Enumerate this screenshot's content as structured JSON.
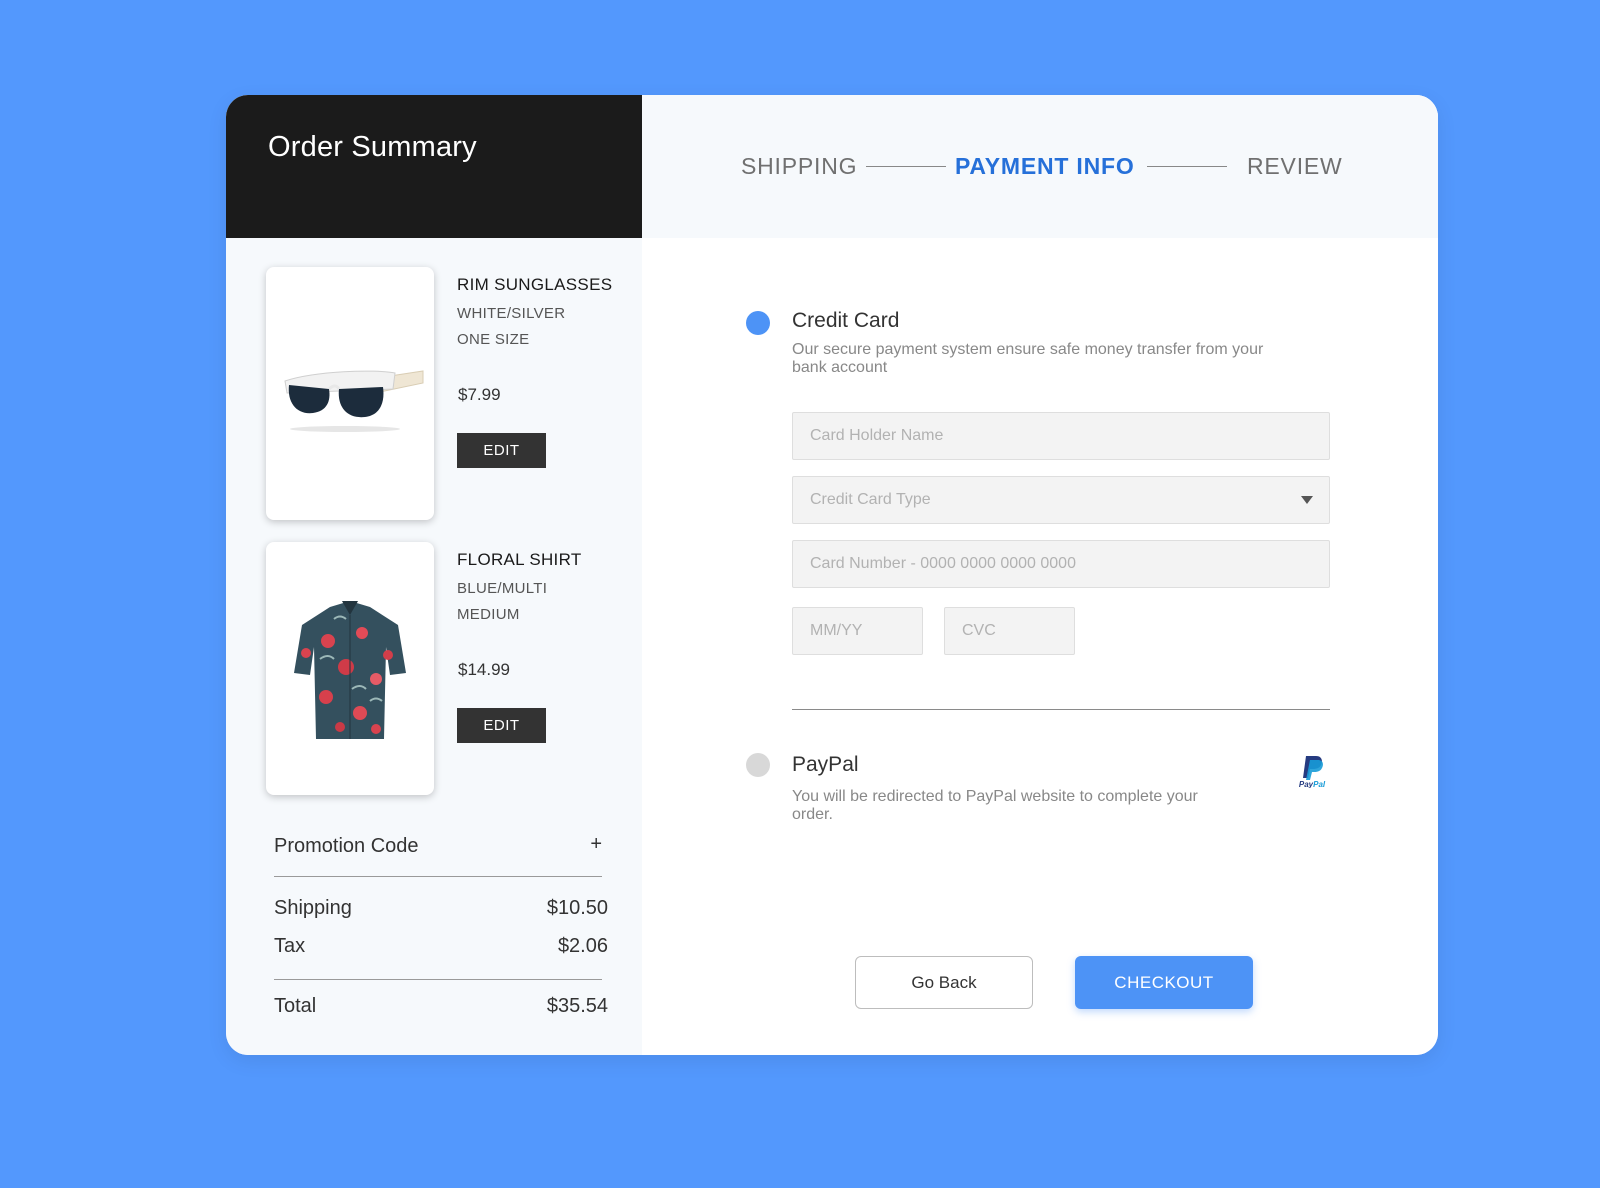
{
  "summary": {
    "title": "Order Summary"
  },
  "items": [
    {
      "name": "RIM SUNGLASSES",
      "color": "WHITE/SILVER",
      "size": "ONE SIZE",
      "price": "$7.99",
      "edit_label": "EDIT"
    },
    {
      "name": "FLORAL SHIRT",
      "color": "BLUE/MULTI",
      "size": "MEDIUM",
      "price": "$14.99",
      "edit_label": "EDIT"
    }
  ],
  "promo": {
    "label": "Promotion Code",
    "plus": "+"
  },
  "costs": {
    "shipping_label": "Shipping",
    "shipping_value": "$10.50",
    "tax_label": "Tax",
    "tax_value": "$2.06",
    "total_label": "Total",
    "total_value": "$35.54"
  },
  "steps": [
    {
      "label": "SHIPPING",
      "active": false
    },
    {
      "label": "PAYMENT INFO",
      "active": true
    },
    {
      "label": "REVIEW",
      "active": false
    }
  ],
  "credit_card": {
    "title": "Credit Card",
    "description": "Our secure payment system ensure safe money transfer from your bank account",
    "selected": true,
    "fields": {
      "holder_placeholder": "Card Holder Name",
      "type_placeholder": "Credit Card Type",
      "number_placeholder": "Card Number - 0000 0000 0000 0000",
      "expiry_placeholder": "MM/YY",
      "cvc_placeholder": "CVC"
    }
  },
  "paypal": {
    "title": "PayPal",
    "description": "You will be redirected to PayPal website to complete your order.",
    "selected": false,
    "logo_text": "PayPal"
  },
  "actions": {
    "back_label": "Go Back",
    "checkout_label": "CHECKOUT"
  },
  "colors": {
    "background": "#5398fd",
    "accent": "#4d93f6",
    "active_step": "#2670d9",
    "header": "#1b1b1b"
  }
}
